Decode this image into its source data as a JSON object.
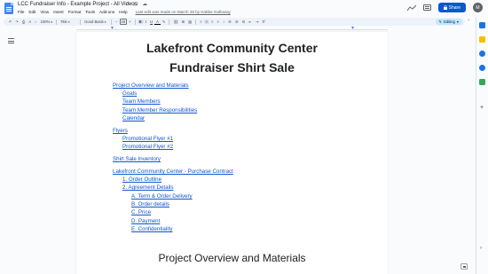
{
  "header": {
    "doc_title": "LCC Fundraiser Info - Example Project - All Videos",
    "star_icon": "☆",
    "move_icon": "⊡",
    "cloud_icon": "☁",
    "menu": [
      "File",
      "Edit",
      "View",
      "Insert",
      "Format",
      "Tools",
      "Add-ons",
      "Help"
    ],
    "last_edit": "Last edit was made on March 29 by Kabbe Galloway",
    "share_label": "Share",
    "avatar_initial": "M"
  },
  "toolbar": {
    "undo": "↶",
    "redo": "↷",
    "print": "⎙",
    "spellcheck": "A",
    "paint": "⌐",
    "zoom": "100%",
    "style": "Title",
    "font": "Good Basis",
    "decrease": "−",
    "size": "26",
    "increase": "+",
    "bold": "B",
    "italic": "I",
    "underline": "U",
    "text_color": "A",
    "highlight": "✎",
    "link": "⛓",
    "comment": "⊞",
    "image": "▨",
    "align_left": "≡",
    "align_center": "≡",
    "align_right": "≡",
    "justify": "≡",
    "line_spacing": "↕",
    "checklist": "☰",
    "bullets": "☰",
    "numbered": "☰",
    "indent_less": "⇤",
    "indent_more": "⇥",
    "clear": "T̸",
    "editing_label": "Editing",
    "collapse": "⌃"
  },
  "document": {
    "title_line1": "Lakefront Community Center",
    "title_line2": "Fundraiser Shirt Sale",
    "toc": [
      {
        "text": "Project Overview and Materials",
        "level": 1
      },
      {
        "text": "Goals",
        "level": 2
      },
      {
        "text": "Team Members",
        "level": 2
      },
      {
        "text": "Team Member Responsibilities",
        "level": 2
      },
      {
        "text": "Calendar",
        "level": 2
      },
      {
        "text": "Flyers",
        "level": 1
      },
      {
        "text": "Promotional Flyer #1",
        "level": 2
      },
      {
        "text": "Promotional Flyer #2",
        "level": 2
      },
      {
        "text": "Shirt Sale Inventory",
        "level": 1
      },
      {
        "text": "Lakefront Community Center - Purchase Contract",
        "level": 1
      },
      {
        "text": "1. Order Outline",
        "level": 2
      },
      {
        "text": "2. Agreement Details",
        "level": 2
      },
      {
        "text": "A. Term & Order Delivery",
        "level": 3
      },
      {
        "text": "B. Order details",
        "level": 3
      },
      {
        "text": "C. Price",
        "level": 3
      },
      {
        "text": "D. Payment",
        "level": 3
      },
      {
        "text": "E. Confidentiality",
        "level": 3
      }
    ],
    "section_heading": "Project Overview and Materials"
  },
  "sidebar": {
    "apps": [
      {
        "name": "calendar-app-icon",
        "color": "#1a73e8"
      },
      {
        "name": "keep-app-icon",
        "color": "#fbbc04"
      },
      {
        "name": "tasks-app-icon",
        "color": "#1a73e8"
      },
      {
        "name": "contacts-app-icon",
        "color": "#1a73e8"
      },
      {
        "name": "maps-app-icon",
        "color": "#34a853"
      }
    ],
    "add_label": "+",
    "hide_label": "›"
  },
  "colors": {
    "link": "#1155cc",
    "share": "#0b57d0",
    "editing_bg": "#c2e7ff"
  }
}
